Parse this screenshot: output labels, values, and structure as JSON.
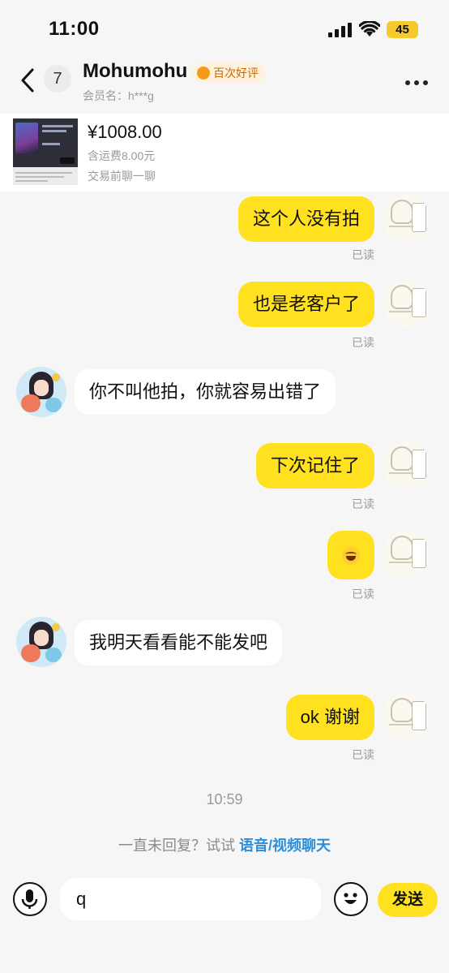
{
  "status_bar": {
    "time": "11:00",
    "battery": "45"
  },
  "header": {
    "unread_count": "7",
    "contact_name": "Mohumohu",
    "rating_badge": "百次好评",
    "member_label": "会员名：h***g"
  },
  "product": {
    "price": "¥1008.00",
    "shipping": "含运费8.00元",
    "note": "交易前聊一聊"
  },
  "messages": [
    {
      "from": "me",
      "text": "这个人没有拍",
      "status": "已读"
    },
    {
      "from": "me",
      "text": "也是老客户了",
      "status": "已读"
    },
    {
      "from": "them",
      "text": "你不叫他拍，你就容易出错了"
    },
    {
      "from": "me",
      "text": "下次记住了",
      "status": "已读"
    },
    {
      "from": "me",
      "emoji": "face-with-tears-of-joy",
      "status": "已读"
    },
    {
      "from": "them",
      "text": "我明天看看能不能发吧"
    },
    {
      "from": "me",
      "text": "ok 谢谢",
      "status": "已读"
    }
  ],
  "timestamp": "10:59",
  "suggestion": {
    "prefix": "一直未回复？试试 ",
    "link": "语音/视频聊天"
  },
  "input": {
    "value": "q",
    "send_label": "发送"
  },
  "icons": {
    "back": "chevron-left-icon",
    "more": "more-horizontal-icon",
    "mic": "microphone-icon",
    "emoji": "smiley-icon",
    "rating": "medal-icon"
  },
  "colors": {
    "accent": "#ffe11f",
    "link": "#2a8fd8",
    "background": "#f6f6f6"
  }
}
